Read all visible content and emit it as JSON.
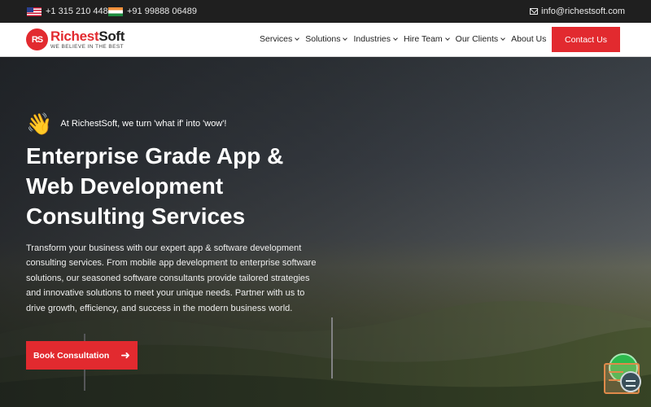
{
  "topbar": {
    "us_phone": "+1 315 210 4488",
    "in_phone": "+91 99888 06489",
    "email": "info@richestsoft.com"
  },
  "header": {
    "logo_mark": "RS",
    "logo_name_part1": "Richest",
    "logo_name_part2": "Soft",
    "logo_tagline": "WE BELIEVE IN THE BEST",
    "nav": [
      {
        "label": "Services",
        "dropdown": true
      },
      {
        "label": "Solutions",
        "dropdown": true
      },
      {
        "label": "Industries",
        "dropdown": true
      },
      {
        "label": "Hire Team",
        "dropdown": true
      },
      {
        "label": "Our Clients",
        "dropdown": true
      },
      {
        "label": "About Us",
        "dropdown": false
      }
    ],
    "contact_label": "Contact Us"
  },
  "hero": {
    "wave_icon": "👋",
    "tagline": "At RichestSoft, we turn 'what if' into 'wow'!",
    "title_line1": "Enterprise Grade App &",
    "title_line2": "Web Development",
    "title_line3": "Consulting Services",
    "description": "Transform your business with our expert app & software development consulting services. From mobile app development to enterprise software solutions, our seasoned software consultants provide tailored strategies and innovative solutions to meet your unique needs. Partner with us to drive growth, efficiency, and success in the modern business world.",
    "cta_label": "Book Consultation",
    "cta_arrow": "➜"
  },
  "colors": {
    "brand_red": "#e22a2f",
    "topbar_bg": "#1f1f1f",
    "chat_green": "#2db94d"
  },
  "icons": {
    "mail": "mail-icon",
    "arrow": "arrow-right-icon",
    "chat": "chat-widget-icon"
  }
}
